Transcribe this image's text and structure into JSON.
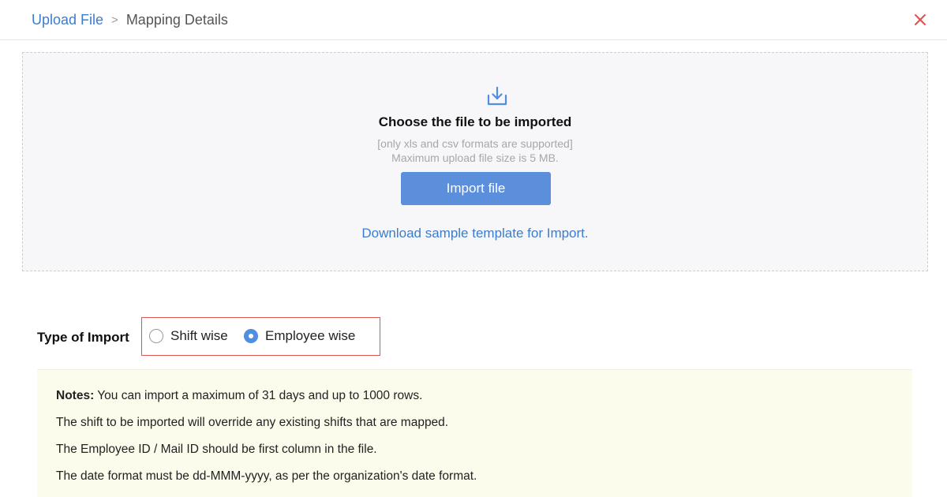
{
  "header": {
    "breadcrumb_link": "Upload File",
    "breadcrumb_separator": ">",
    "breadcrumb_current": "Mapping Details",
    "close_icon": "close-icon",
    "close_color": "#e0504f"
  },
  "dropzone": {
    "icon": "download-tray-icon",
    "title": "Choose the file to be imported",
    "hint_formats": "[only xls and csv formats are supported]",
    "hint_size": "Maximum upload file size is 5 MB.",
    "import_button": "Import file",
    "template_link": "Download sample template for Import."
  },
  "import_type": {
    "label": "Type of Import",
    "options": [
      {
        "label": "Shift wise",
        "selected": false
      },
      {
        "label": "Employee wise",
        "selected": true
      }
    ]
  },
  "notes": {
    "heading": "Notes:",
    "line1_rest": " You can import a maximum of 31 days and up to 1000 rows.",
    "line2": "The shift to be imported will override any existing shifts that are mapped.",
    "line3": "The Employee ID / Mail ID should be first column in the file.",
    "line4": "The date format must be dd-MMM-yyyy, as per the organization's date format."
  },
  "colors": {
    "accent": "#5b8fdb",
    "link": "#3d7cc9",
    "highlight_border": "#e0504f",
    "notes_bg": "#fbfcec"
  }
}
